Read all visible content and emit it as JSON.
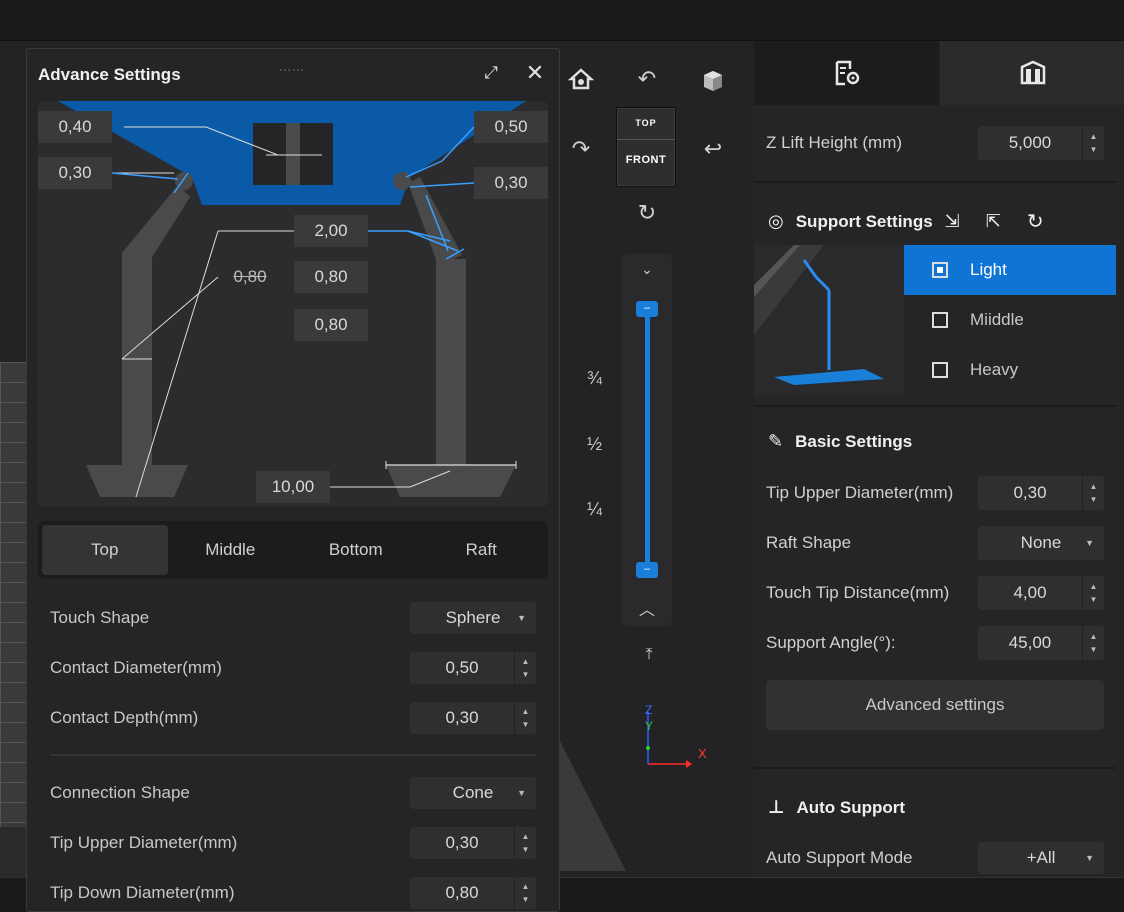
{
  "viewport": {
    "fractions": [
      "¾",
      "½",
      "¼"
    ],
    "cube": {
      "top": "TOP",
      "front": "FRONT"
    },
    "axes": {
      "z": "Z",
      "y": "Y",
      "x": "X"
    },
    "slider": {
      "top_handle": "–",
      "bottom_handle": "–"
    }
  },
  "dialog": {
    "title": "Advance Settings",
    "diagram_labels": {
      "top_left": "0,40",
      "top_right": "0,50",
      "left_mid": "0,30",
      "right_mid": "0,30",
      "center1": "2,00",
      "center_left": "0,80",
      "center2": "0,80",
      "center3": "0,80",
      "bottom": "10,00"
    },
    "tabs": [
      "Top",
      "Middle",
      "Bottom",
      "Raft"
    ],
    "fields": {
      "touch_shape": {
        "label": "Touch Shape",
        "value": "Sphere"
      },
      "contact_diameter": {
        "label": "Contact Diameter(mm)",
        "value": "0,50"
      },
      "contact_depth": {
        "label": "Contact Depth(mm)",
        "value": "0,30"
      },
      "connection_shape": {
        "label": "Connection Shape",
        "value": "Cone"
      },
      "tip_upper": {
        "label": "Tip Upper Diameter(mm)",
        "value": "0,30"
      },
      "tip_down": {
        "label": "Tip Down Diameter(mm)",
        "value": "0,80"
      }
    }
  },
  "right_panel": {
    "z_lift": {
      "label": "Z Lift Height (mm)",
      "value": "5,000"
    },
    "support_settings": {
      "title": "Support Settings",
      "levels": [
        "Light",
        "Miiddle",
        "Heavy"
      ],
      "selected": "Light"
    },
    "basic_settings": {
      "title": "Basic Settings",
      "tip_upper": {
        "label": "Tip Upper Diameter(mm)",
        "value": "0,30"
      },
      "raft_shape": {
        "label": "Raft Shape",
        "value": "None"
      },
      "touch_tip": {
        "label": "Touch Tip Distance(mm)",
        "value": "4,00"
      },
      "support_angle": {
        "label": "Support Angle(°):",
        "value": "45,00"
      },
      "advanced_button": "Advanced settings"
    },
    "auto_support": {
      "title": "Auto Support",
      "mode": {
        "label": "Auto Support Mode",
        "value": "+All"
      }
    }
  },
  "colors": {
    "accent": "#0f74d4",
    "diagram_blue": "#0a5aa8",
    "line_blue": "#3aa0ff"
  }
}
